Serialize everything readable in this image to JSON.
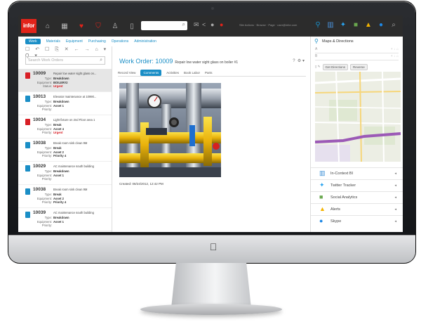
{
  "app": {
    "logo": "infor",
    "search_icon": "magnifier-icon",
    "links": "Site Actions · Browse · Page · user@infor.com"
  },
  "nav": {
    "items": [
      "Work",
      "Materials",
      "Equipment",
      "Purchasing",
      "Operations",
      "Administration"
    ]
  },
  "left": {
    "tools": "☐ ↶ ☐ ⎘ ✕   ← →   ⌂ ▾  Q ▾",
    "search_placeholder": "Search Work Orders",
    "orders": [
      {
        "num": "10009",
        "desc": "Repair low water sight glass on...",
        "fields": [
          [
            "Type:",
            "Breakdown"
          ],
          [
            "Equipment:",
            "BOILER#2"
          ],
          [
            "Status:",
            "Urgent"
          ]
        ],
        "red": true
      },
      {
        "num": "10013",
        "desc": "Elevator maintenance at 10990...",
        "fields": [
          [
            "Type:",
            "Breakdown"
          ],
          [
            "Equipment:",
            "Asset 1"
          ],
          [
            "Priority:",
            ""
          ]
        ],
        "red": false
      },
      {
        "num": "10034",
        "desc": "Light fixture on 2nd Floor area 1",
        "fields": [
          [
            "Type:",
            "Break"
          ],
          [
            "Equipment:",
            "Asset 4"
          ],
          [
            "Priority:",
            "Urgent"
          ]
        ],
        "red": true
      },
      {
        "num": "10038",
        "desc": "Break room sink clean 9M",
        "fields": [
          [
            "Type:",
            "Break"
          ],
          [
            "Equipment:",
            "Asset 2"
          ],
          [
            "Priority:",
            "Priority 4"
          ]
        ],
        "red": false
      },
      {
        "num": "10029",
        "desc": "AC maintenance south building",
        "fields": [
          [
            "Type:",
            "Breakdown"
          ],
          [
            "Equipment:",
            "Asset 1"
          ],
          [
            "Priority:",
            ""
          ]
        ],
        "red": false
      },
      {
        "num": "10038",
        "desc": "Break room sink clean 9M",
        "fields": [
          [
            "Type:",
            "Break"
          ],
          [
            "Equipment:",
            "Asset 2"
          ],
          [
            "Priority:",
            "Priority 4"
          ]
        ],
        "red": false
      },
      {
        "num": "10039",
        "desc": "AC maintenance south building",
        "fields": [
          [
            "Type:",
            "Breakdown"
          ],
          [
            "Equipment:",
            "Asset 1"
          ],
          [
            "Priority:",
            ""
          ]
        ],
        "red": false
      }
    ]
  },
  "main": {
    "title": "Work Order: 10009",
    "subtitle": "Repair low water sight glass on boiler #1",
    "tabs": [
      "Record View",
      "Comments",
      "Activities",
      "Book Labor",
      "Parts"
    ],
    "active_tab": "Comments",
    "created": "Created: 08/24/2012, 12:42 PM"
  },
  "right": {
    "maps_title": "Maps & Directions",
    "addr_a": "A",
    "addr_b": "B",
    "btn_get": "Get Directions",
    "btn_reverse": "Reverse",
    "widgets": [
      {
        "label": "In-Context BI",
        "icon": "bar-chart-icon",
        "color": "#3b8fd6"
      },
      {
        "label": "Twitter Tracker",
        "icon": "twitter-icon",
        "color": "#2aa3ef"
      },
      {
        "label": "Social Analytics",
        "icon": "social-analytics-icon",
        "color": "#6aa84f"
      },
      {
        "label": "Alerts",
        "icon": "alert-icon",
        "color": "#f4b400"
      },
      {
        "label": "Skype",
        "icon": "skype-icon",
        "color": "#1e88e5"
      }
    ]
  },
  "colors": {
    "accent": "#1a8ec6",
    "alert": "#d81f26",
    "topbar": "#2c2c2c"
  }
}
